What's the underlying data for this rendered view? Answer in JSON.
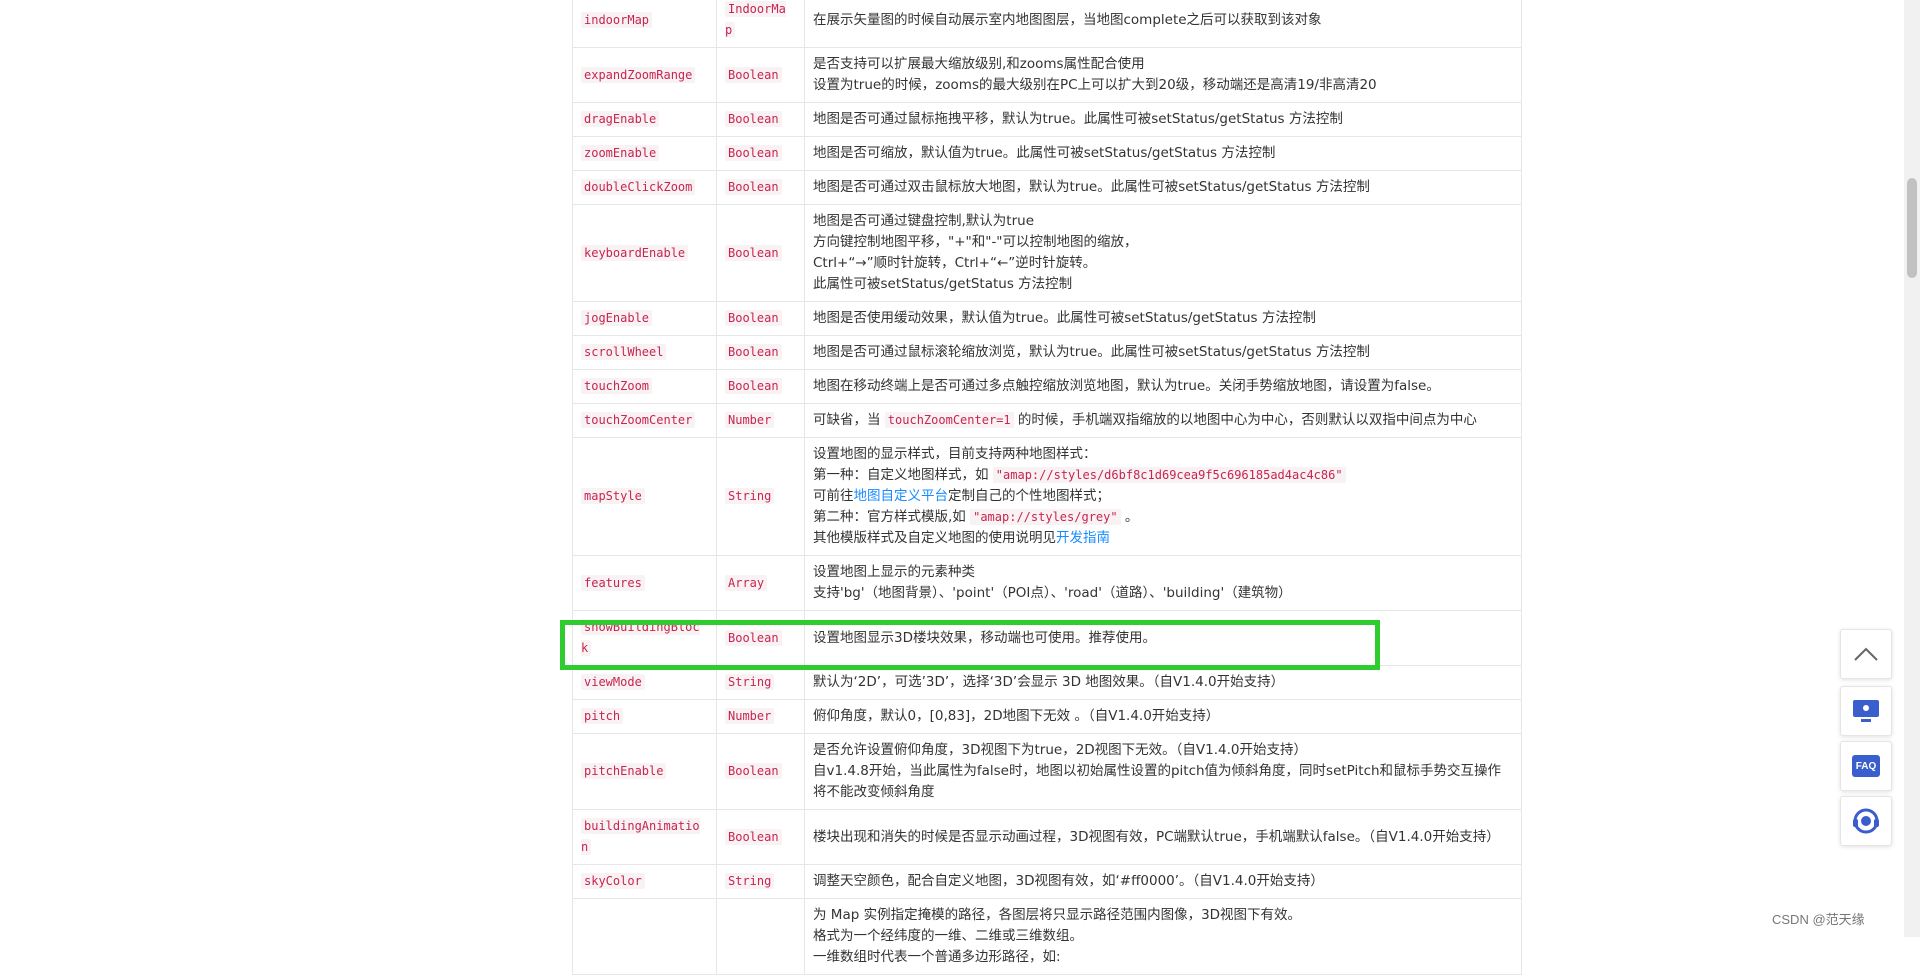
{
  "rows": [
    {
      "name": "indoorMap",
      "type": "IndoorMap",
      "desc": [
        "在展示矢量图的时候自动展示室内地图图层，当地图complete之后可以获取到该对象"
      ]
    },
    {
      "name": "expandZoomRange",
      "type": "Boolean",
      "desc": [
        "是否支持可以扩展最大缩放级别,和zooms属性配合使用",
        "设置为true的时候，zooms的最大级别在PC上可以扩大到20级，移动端还是高清19/非高清20"
      ]
    },
    {
      "name": "dragEnable",
      "type": "Boolean",
      "desc": [
        "地图是否可通过鼠标拖拽平移，默认为true。此属性可被setStatus/getStatus 方法控制"
      ]
    },
    {
      "name": "zoomEnable",
      "type": "Boolean",
      "desc": [
        "地图是否可缩放，默认值为true。此属性可被setStatus/getStatus 方法控制"
      ]
    },
    {
      "name": "doubleClickZoom",
      "type": "Boolean",
      "desc": [
        "地图是否可通过双击鼠标放大地图，默认为true。此属性可被setStatus/getStatus 方法控制"
      ]
    },
    {
      "name": "keyboardEnable",
      "type": "Boolean",
      "desc": [
        "地图是否可通过键盘控制,默认为true",
        "方向键控制地图平移，\"+\"和\"-\"可以控制地图的缩放，",
        "Ctrl+“→”顺时针旋转，Ctrl+“←”逆时针旋转。",
        "此属性可被setStatus/getStatus 方法控制"
      ]
    },
    {
      "name": "jogEnable",
      "type": "Boolean",
      "desc": [
        "地图是否使用缓动效果，默认值为true。此属性可被setStatus/getStatus 方法控制"
      ]
    },
    {
      "name": "scrollWheel",
      "type": "Boolean",
      "desc": [
        "地图是否可通过鼠标滚轮缩放浏览，默认为true。此属性可被setStatus/getStatus 方法控制"
      ]
    },
    {
      "name": "touchZoom",
      "type": "Boolean",
      "desc": [
        "地图在移动终端上是否可通过多点触控缩放浏览地图，默认为true。关闭手势缩放地图，请设置为false。"
      ]
    }
  ],
  "touchZoomCenter": {
    "name": "touchZoomCenter",
    "type": "Number",
    "pre": "可缺省，当 ",
    "code": "touchZoomCenter=1",
    "post": " 的时候，手机端双指缩放的以地图中心为中心，否则默认以双指中间点为中心"
  },
  "mapStyle": {
    "name": "mapStyle",
    "type": "String",
    "l1": "设置地图的显示样式，目前支持两种地图样式：",
    "l2_pre": "第一种：自定义地图样式，如 ",
    "l2_code": "\"amap://styles/d6bf8c1d69cea9f5c696185ad4ac4c86\"",
    "l3_pre": "可前往",
    "l3_link": "地图自定义平台",
    "l3_post": "定制自己的个性地图样式；",
    "l4_pre": "第二种：官方样式模版,如 ",
    "l4_code": "\"amap://styles/grey\"",
    "l4_post": " 。",
    "l5_pre": "其他模版样式及自定义地图的使用说明见",
    "l5_link": "开发指南"
  },
  "rows2": [
    {
      "name": "features",
      "type": "Array",
      "desc": [
        "设置地图上显示的元素种类",
        "支持'bg'（地图背景）、'point'（POI点）、'road'（道路）、'building'（建筑物）"
      ]
    },
    {
      "name": "showBuildingBlock",
      "type": "Boolean",
      "desc": [
        "设置地图显示3D楼块效果，移动端也可使用。推荐使用。"
      ]
    },
    {
      "name": "viewMode",
      "type": "String",
      "desc": [
        "默认为‘2D’，可选’3D’，选择‘3D’会显示 3D 地图效果。（自V1.4.0开始支持）"
      ]
    },
    {
      "name": "pitch",
      "type": "Number",
      "desc": [
        "俯仰角度，默认0，[0,83]，2D地图下无效 。（自V1.4.0开始支持）"
      ]
    },
    {
      "name": "pitchEnable",
      "type": "Boolean",
      "desc": [
        "是否允许设置俯仰角度，3D视图下为true，2D视图下无效。（自V1.4.0开始支持）",
        "自v1.4.8开始，当此属性为false时，地图以初始属性设置的pitch值为倾斜角度，同时setPitch和鼠标手势交互操作将不能改变倾斜角度"
      ]
    },
    {
      "name": "buildingAnimation",
      "type": "Boolean",
      "desc": [
        "楼块出现和消失的时候是否显示动画过程，3D视图有效，PC端默认true，手机端默认false。（自V1.4.0开始支持）"
      ]
    },
    {
      "name": "skyColor",
      "type": "String",
      "desc": [
        "调整天空颜色，配合自定义地图，3D视图有效，如‘#ff0000’。（自V1.4.0开始支持）"
      ]
    },
    {
      "name": "",
      "type": "",
      "desc": [
        "为 Map 实例指定掩模的路径，各图层将只显示路径范围内图像，3D视图下有效。",
        "格式为一个经纬度的一维、二维或三维数组。",
        "一维数组时代表一个普通多边形路径，如:"
      ]
    }
  ],
  "watermark": "CSDN @范天缘",
  "tools": {
    "faq_label": "FAQ"
  },
  "colors": {
    "highlight": "#2ecc2e",
    "code_text": "#c7254e",
    "link": "#1a8cff"
  }
}
